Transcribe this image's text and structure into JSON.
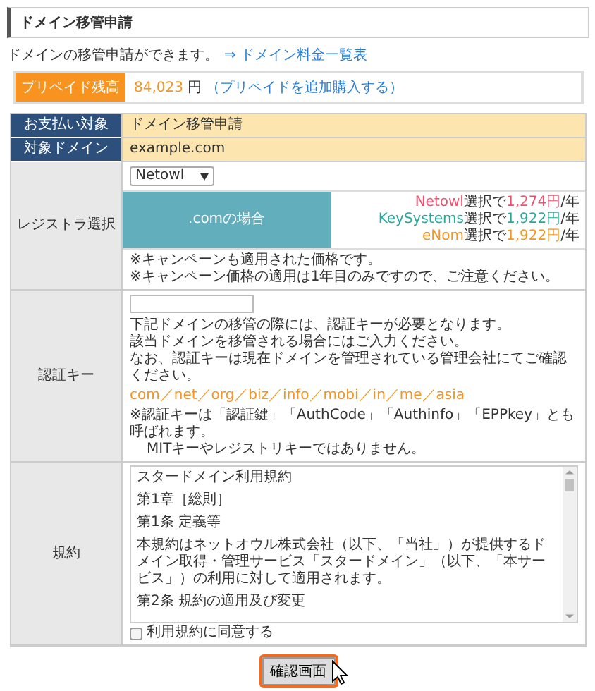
{
  "header": {
    "title": "ドメイン移管申請"
  },
  "intro": {
    "text": "ドメインの移管申請ができます。",
    "link": "⇒ ドメイン料金一覧表"
  },
  "prepaid": {
    "label": "プリペイド残高",
    "amount": "84,023",
    "unit": "円",
    "link": "（プリペイドを追加購入する）"
  },
  "rows": [
    {
      "kind": "text",
      "label": "お支払い対象",
      "value": "ドメイン移管申請"
    },
    {
      "kind": "text",
      "label": "対象ドメイン",
      "value": "example.com"
    }
  ],
  "registrar": {
    "label": "レジストラ選択",
    "select": "Netowl",
    "tld_label": ".comの場合",
    "prices": [
      {
        "name": "Netowl",
        "suffix": "選択で",
        "price": "1,274円",
        "per": "/年",
        "color": "#f0506e"
      },
      {
        "name": "KeySystems",
        "suffix": "選択で",
        "price": "1,922円",
        "per": "/年",
        "color": "#2aa79b"
      },
      {
        "name": "eNom",
        "suffix": "選択で",
        "price": "1,922円",
        "per": "/年",
        "color": "#f7941d"
      }
    ],
    "notes": [
      "※キャンペーンも適用された価格です。",
      "※キャンペーン価格の適用は1年目のみですので、ご注意ください。"
    ]
  },
  "auth": {
    "label": "認証キー",
    "lines": [
      "下記ドメインの移管の際には、認証キーが必要となります。",
      "該当ドメインを移管される場合にはご入力ください。",
      "なお、認証キーは現在ドメインを管理されている管理会社にてご確認ください。"
    ],
    "tlds": "com／net／org／biz／info／mobi／in／me／asia",
    "notes": [
      "※認証キーは「認証鍵」「AuthCode」「Authinfo」「EPPkey」とも呼ばれます。",
      "MITキーやレジストリキーではありません。"
    ]
  },
  "terms": {
    "label": "規約",
    "lines": [
      "スタードメイン利用規約",
      "第1章［総則］",
      "第1条 定義等",
      "本規約はネットオウル株式会社（以下、「当社」）が提供するドメイン取得・管理サービス「スタードメイン」（以下、「本サービス」）の利用に対して適用されます。",
      "第2条 規約の適用及び変更"
    ],
    "agree": {
      "label": "利用規約に同意する",
      "checked": false
    }
  },
  "submit": "確認画面"
}
